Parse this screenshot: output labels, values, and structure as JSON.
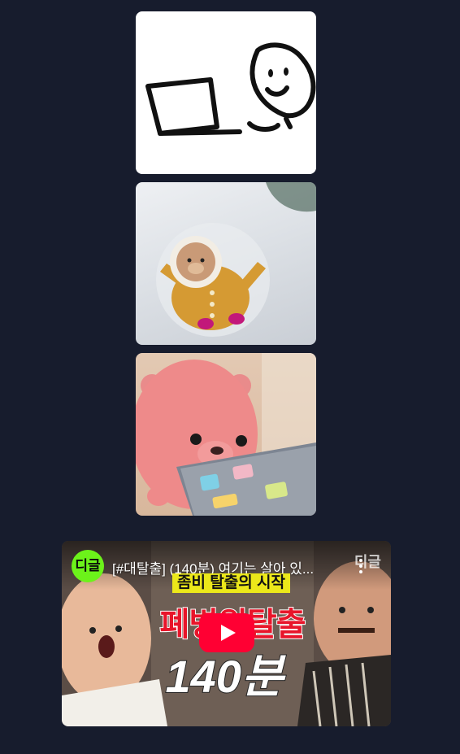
{
  "stickers": [
    {
      "name": "person-laptop-doodle"
    },
    {
      "name": "bear-snow-angel"
    },
    {
      "name": "pink-beaver-laptop"
    }
  ],
  "video": {
    "channel_logo_text": "디글",
    "title": "[#대탈출] (140분) 여기는 살아 있...",
    "watermark": "디글",
    "thumb_subtitle": "좀비 탈출의 시작",
    "thumb_headline": "폐병원탈출",
    "thumb_duration": "140분"
  }
}
